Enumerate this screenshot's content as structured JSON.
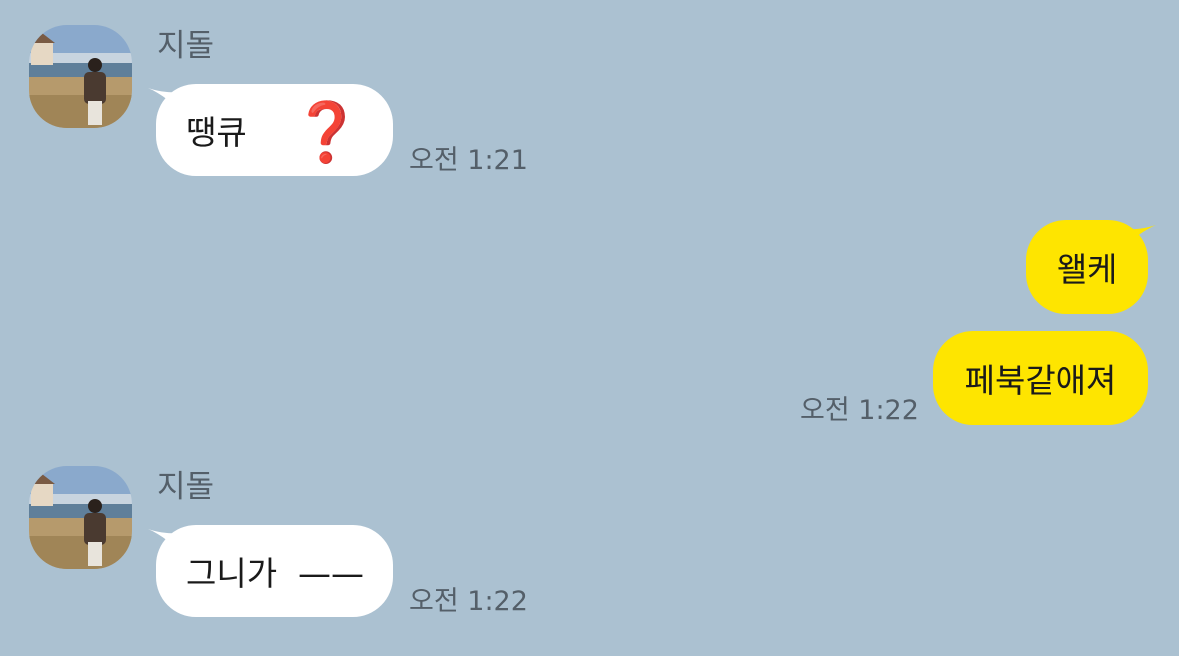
{
  "colors": {
    "background": "#abc1d1",
    "incoming_bubble": "#ffffff",
    "outgoing_bubble": "#fee500",
    "meta_text": "#545f69"
  },
  "messages": [
    {
      "sender": "지돌",
      "text": "땡큐",
      "emoji": "❓",
      "time": "오전 1:21",
      "direction": "incoming"
    },
    {
      "text": "왤케",
      "direction": "outgoing"
    },
    {
      "text": "페북같애져",
      "time": "오전 1:22",
      "direction": "outgoing"
    },
    {
      "sender": "지돌",
      "text": "그니가  ——",
      "time": "오전 1:22",
      "direction": "incoming"
    }
  ]
}
